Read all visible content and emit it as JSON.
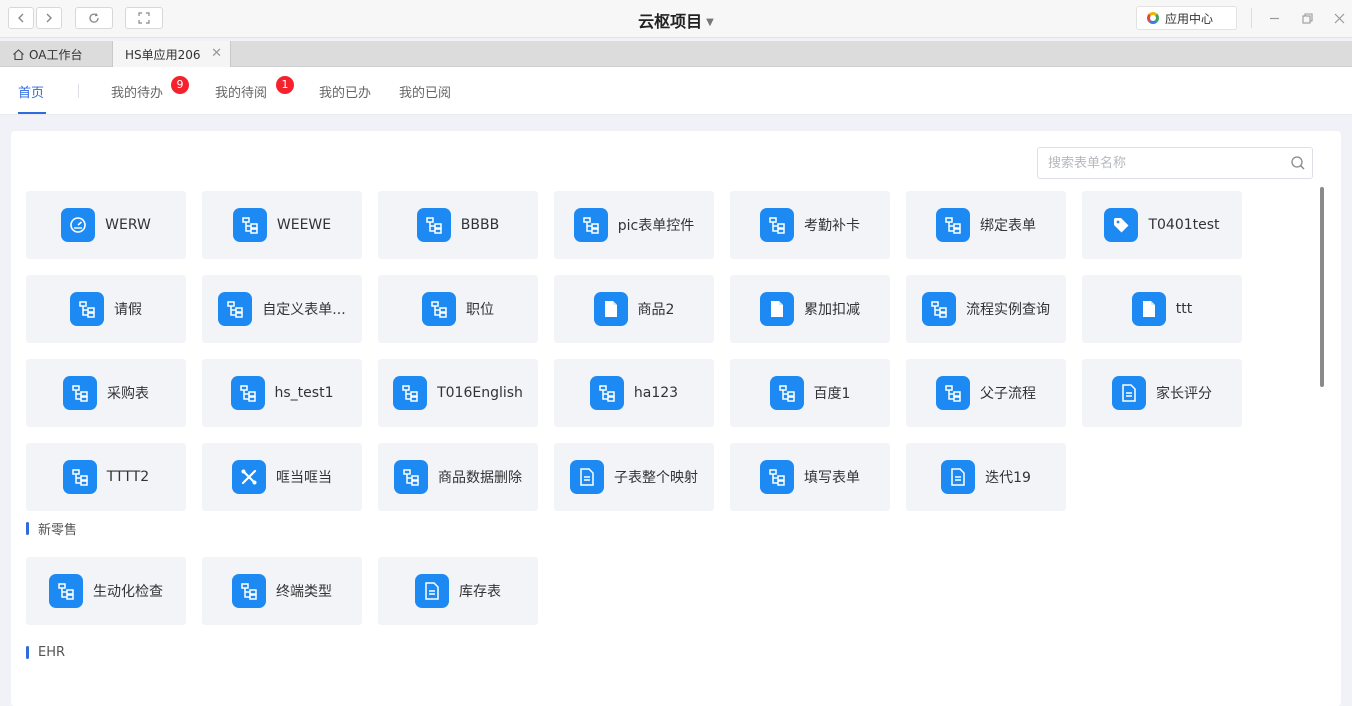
{
  "titlebar": {
    "title": "云枢项目",
    "app_center_label": "应用中心"
  },
  "tabs": [
    {
      "label": "OA工作台"
    },
    {
      "label": "HS单应用206"
    }
  ],
  "nav": {
    "items": [
      {
        "label": "首页",
        "badge": ""
      },
      {
        "label": "我的待办",
        "badge": "9"
      },
      {
        "label": "我的待阅",
        "badge": "1"
      },
      {
        "label": "我的已办",
        "badge": ""
      },
      {
        "label": "我的已阅",
        "badge": ""
      }
    ]
  },
  "search": {
    "placeholder": "搜索表单名称"
  },
  "colors": {
    "accent": "#2d6be0",
    "icon_bg": "#1d8af3",
    "badge": "#f5222d",
    "tile_bg": "#f2f4f8"
  },
  "forms": [
    {
      "label": "WERW",
      "icon": "gauge-icon"
    },
    {
      "label": "WEEWE",
      "icon": "workflow-icon"
    },
    {
      "label": "BBBB",
      "icon": "workflow-icon"
    },
    {
      "label": "pic表单控件",
      "icon": "workflow-icon"
    },
    {
      "label": "考勤补卡",
      "icon": "workflow-icon"
    },
    {
      "label": "绑定表单",
      "icon": "workflow-icon"
    },
    {
      "label": "T0401test",
      "icon": "tag-icon"
    },
    {
      "label": "请假",
      "icon": "workflow-icon"
    },
    {
      "label": "自定义表单...",
      "icon": "workflow-icon"
    },
    {
      "label": "职位",
      "icon": "workflow-icon"
    },
    {
      "label": "商品2",
      "icon": "file-icon"
    },
    {
      "label": "累加扣减",
      "icon": "file-icon"
    },
    {
      "label": "流程实例查询",
      "icon": "workflow-icon"
    },
    {
      "label": "ttt",
      "icon": "file-icon"
    },
    {
      "label": "采购表",
      "icon": "workflow-icon"
    },
    {
      "label": "hs_test1",
      "icon": "workflow-icon"
    },
    {
      "label": "T016English",
      "icon": "workflow-icon"
    },
    {
      "label": "ha123",
      "icon": "workflow-icon"
    },
    {
      "label": "百度1",
      "icon": "workflow-icon"
    },
    {
      "label": "父子流程",
      "icon": "workflow-icon"
    },
    {
      "label": "家长评分",
      "icon": "document-icon"
    },
    {
      "label": "TTTT2",
      "icon": "workflow-icon"
    },
    {
      "label": "哐当哐当",
      "icon": "tools-icon"
    },
    {
      "label": "商品数据删除",
      "icon": "workflow-icon"
    },
    {
      "label": "子表整个映射",
      "icon": "document-icon"
    },
    {
      "label": "填写表单",
      "icon": "workflow-icon"
    },
    {
      "label": "迭代19",
      "icon": "document-icon"
    }
  ],
  "sections": [
    {
      "title": "新零售",
      "forms": [
        {
          "label": "生动化检查",
          "icon": "workflow-icon"
        },
        {
          "label": "终端类型",
          "icon": "workflow-icon"
        },
        {
          "label": "库存表",
          "icon": "document-icon"
        }
      ]
    },
    {
      "title": "EHR",
      "forms": []
    }
  ]
}
